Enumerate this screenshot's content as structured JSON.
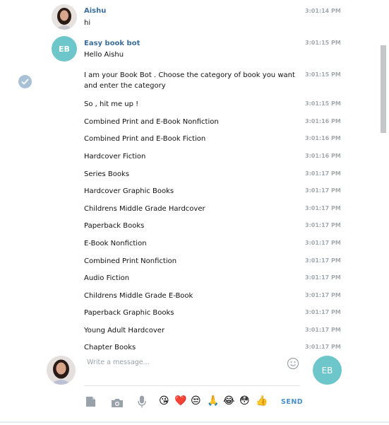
{
  "conversation": {
    "user_name": "Aishu",
    "bot_name": "Easy book bot",
    "bot_initials": "EB",
    "messages": [
      {
        "text": "hi",
        "time": "3:01:14 PM"
      },
      {
        "text": "Hello Aishu",
        "time": "3:01:15 PM"
      },
      {
        "text": "I am your Book Bot . Choose the category of book you  want and enter the category",
        "time": "3:01:15 PM"
      },
      {
        "text": "So , hit me up !",
        "time": "3:01:15 PM"
      },
      {
        "text": "Combined Print and E-Book Nonfiction",
        "time": "3:01:16 PM"
      },
      {
        "text": "Combined Print and E-Book Fiction",
        "time": "3:01:16 PM"
      },
      {
        "text": "Hardcover Fiction",
        "time": "3:01:16 PM"
      },
      {
        "text": "Series Books",
        "time": "3:01:17 PM"
      },
      {
        "text": "Hardcover Graphic Books",
        "time": "3:01:17 PM"
      },
      {
        "text": "Childrens Middle Grade Hardcover",
        "time": "3:01:17 PM"
      },
      {
        "text": "Paperback Books",
        "time": "3:01:17 PM"
      },
      {
        "text": "E-Book Nonfiction",
        "time": "3:01:17 PM"
      },
      {
        "text": "Combined Print Nonfiction",
        "time": "3:01:17 PM"
      },
      {
        "text": "Audio Fiction",
        "time": "3:01:17 PM"
      },
      {
        "text": "Childrens Middle Grade E-Book",
        "time": "3:01:17 PM"
      },
      {
        "text": "Paperback Graphic Books",
        "time": "3:01:17 PM"
      },
      {
        "text": "Young Adult Hardcover",
        "time": "3:01:17 PM"
      },
      {
        "text": "Chapter Books",
        "time": "3:01:17 PM"
      }
    ]
  },
  "composer": {
    "placeholder": "Write a message...",
    "send_label": "SEND",
    "icons": [
      "attach-file-icon",
      "camera-icon",
      "microphone-icon",
      "emoji-toggle-icon"
    ],
    "emojis": [
      "😘",
      "❤️",
      "😒",
      "🙏",
      "😂",
      "😳",
      "👍"
    ]
  },
  "colors": {
    "sender_name": "#3a6d99",
    "timestamp": "#a4a9ad",
    "avatar_bot": "#6cc6ca",
    "send": "#4a90c8"
  }
}
